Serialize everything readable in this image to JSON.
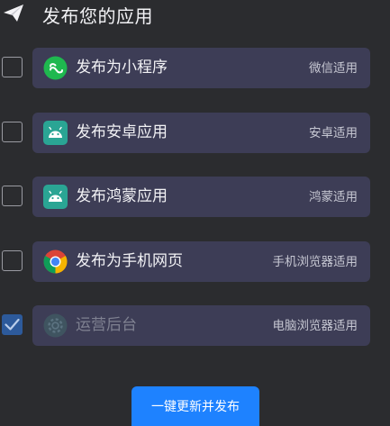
{
  "header": {
    "title": "发布您的应用",
    "icon": "paper-plane-icon"
  },
  "rows": [
    {
      "label": "发布为小程序",
      "hint": "微信适用",
      "icon": "wechat-miniprogram-icon",
      "checked": false
    },
    {
      "label": "发布安卓应用",
      "hint": "安卓适用",
      "icon": "android-icon",
      "checked": false
    },
    {
      "label": "发布鸿蒙应用",
      "hint": "鸿蒙适用",
      "icon": "harmonyos-icon",
      "checked": false
    },
    {
      "label": "发布为手机网页",
      "hint": "手机浏览器适用",
      "icon": "chrome-icon",
      "checked": false
    },
    {
      "label": "运营后台",
      "hint": "电脑浏览器适用",
      "icon": "gear-icon",
      "checked": true
    }
  ],
  "actions": {
    "publish_label": "一键更新并发布"
  },
  "colors": {
    "background": "#2b2c2f",
    "card": "#3d3d56",
    "accent": "#1e82ff",
    "checked": "#2d5a9b"
  }
}
